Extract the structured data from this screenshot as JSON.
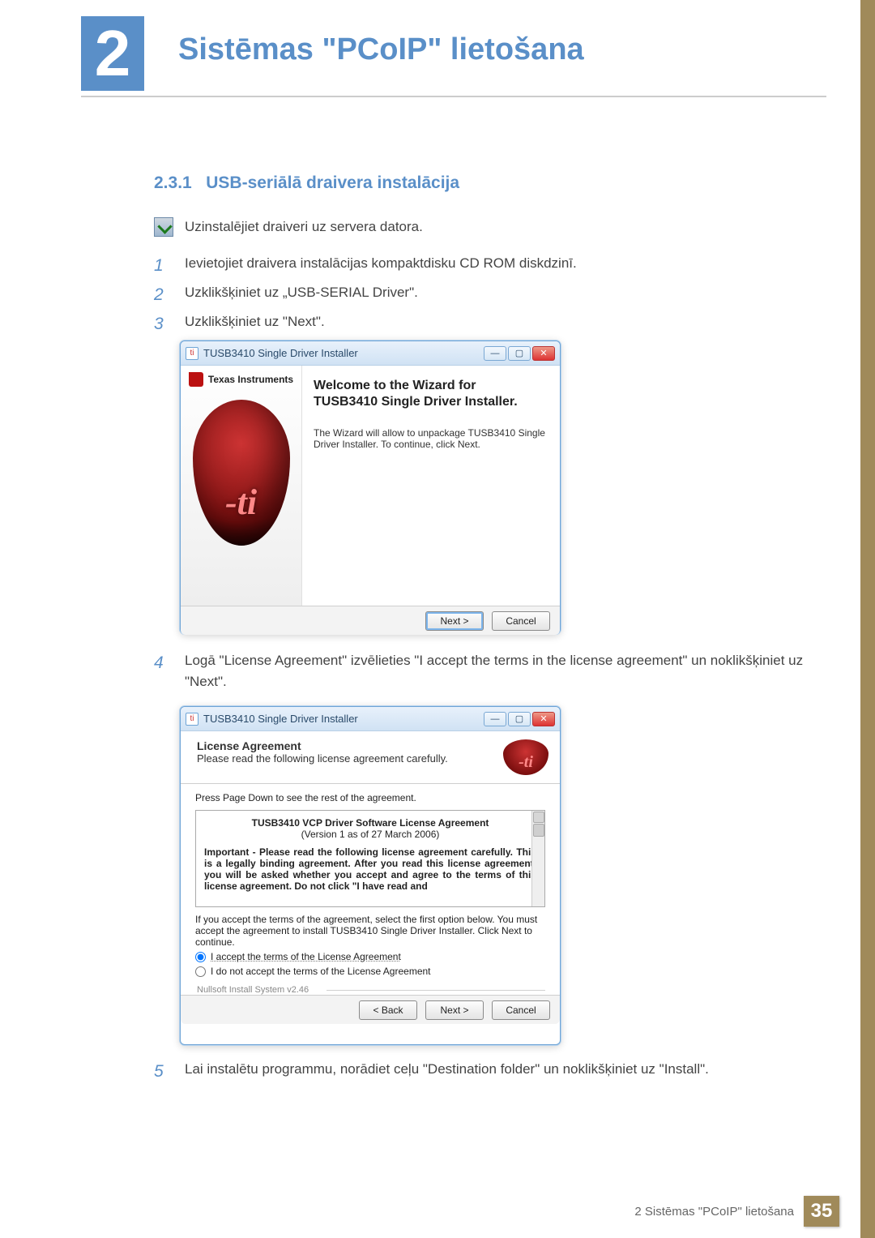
{
  "chapter": {
    "number": "2",
    "title": "Sistēmas \"PCoIP\" lietošana"
  },
  "section": {
    "num": "2.3.1",
    "title": "USB-seriālā draivera instalācija"
  },
  "note": "Uzinstalējiet draiveri uz servera datora.",
  "steps": {
    "s1": {
      "n": "1",
      "t": "Ievietojiet draivera instalācijas kompaktdisku CD ROM diskdzinī."
    },
    "s2": {
      "n": "2",
      "t": "Uzklikšķiniet uz „USB-SERIAL Driver\"."
    },
    "s3": {
      "n": "3",
      "t": "Uzklikšķiniet uz \"Next\"."
    },
    "s4": {
      "n": "4",
      "t": "Logā \"License Agreement\" izvēlieties \"I accept the terms in the license agreement\" un noklikšķiniet uz \"Next\"."
    },
    "s5": {
      "n": "5",
      "t": "Lai instalētu programmu, norādiet ceļu \"Destination folder\" un noklikšķiniet uz \"Install\"."
    }
  },
  "installer1": {
    "title": "TUSB3410 Single Driver Installer",
    "brand": "Texas Instruments",
    "headline1": "Welcome to the Wizard for",
    "headline2": "TUSB3410 Single Driver Installer.",
    "desc": "The Wizard will allow to unpackage TUSB3410 Single Driver Installer. To continue, click Next.",
    "next": "Next >",
    "cancel": "Cancel"
  },
  "installer2": {
    "title": "TUSB3410 Single Driver Installer",
    "head_b": "License Agreement",
    "head_s": "Please read the following license agreement carefully.",
    "press": "Press Page Down to see the rest of the agreement.",
    "lic_title": "TUSB3410 VCP Driver Software License Agreement",
    "lic_ver": "(Version 1 as of 27 March 2006)",
    "lic_body": "Important - Please read the following license agreement carefully. This is a legally binding agreement.  After you read this license agreement, you will be asked whether you accept and agree to the terms of this license agreement.  Do not click  \"I have read and",
    "accept_hint": "If you accept the terms of the agreement, select the first option below. You must accept the agreement to install TUSB3410 Single Driver Installer. Click Next to continue.",
    "opt_accept": "I accept the terms of the License Agreement",
    "opt_reject": "I do not accept the terms of the License Agreement",
    "sysver": "Nullsoft Install System v2.46",
    "back": "< Back",
    "next": "Next >",
    "cancel": "Cancel"
  },
  "footer": {
    "text": "2 Sistēmas \"PCoIP\" lietošana",
    "page": "35"
  }
}
